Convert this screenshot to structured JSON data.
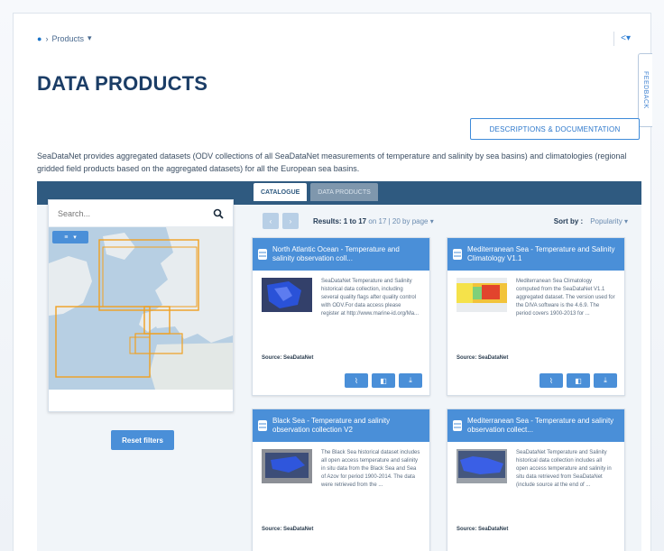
{
  "breadcrumb": {
    "home_icon": "home-icon",
    "label": "Products",
    "separator": "›"
  },
  "header": {
    "share_icon": "share-icon",
    "feedback": "FEEDBACK"
  },
  "page_title": "DATA PRODUCTS",
  "doc_button": "DESCRIPTIONS & DOCUMENTATION",
  "intro": "SeaDataNet provides aggregated datasets (ODV collections of all SeaDataNet measurements of temperature and salinity by sea basins) and climatologies (regional gridded field products based on the aggregated datasets) for all the European sea basins.",
  "search": {
    "placeholder": "Search..."
  },
  "map": {
    "layer_label": "≡"
  },
  "reset_button": "Reset filters",
  "tabs": [
    "CATALOGUE",
    "DATA PRODUCTS"
  ],
  "pager": {
    "results_label": "Results: 1 to 17",
    "results_extra": "on 17 | 20 by page ▾",
    "sort_label": "Sort by :",
    "sort_value": "Popularity ▾"
  },
  "cards": [
    {
      "title": "North Atlantic Ocean - Temperature and salinity observation coll...",
      "text": "SeaDataNet Temperature and Salinity historical data collection, including several quality flags after quality control with ODV.For data access please register at http://www.marine-id.org/Ma...",
      "source": "Source: SeaDataNet"
    },
    {
      "title": "Mediterranean Sea - Temperature and Salinity Climatology V1.1",
      "text": "Mediterranean Sea Climatology computed from the SeaDataNet V1.1 aggregated dataset. The version used for the DIVA software is the 4.6.9. The period covers 1900-2013 for ...",
      "source": "Source: SeaDataNet"
    },
    {
      "title": "Black Sea - Temperature and salinity observation collection V2",
      "text": "The Black Sea historical dataset includes all open access temperature and salinity in situ data from the Black Sea and Sea of Azov for period 1900-2014. The data were retrieved from the ...",
      "source": "Source: SeaDataNet"
    },
    {
      "title": "Mediterranean Sea - Temperature and salinity observation collect...",
      "text": "SeaDataNet Temperature and Salinity historical data collection includes all open access temperature and salinity in situ data retrieved from SeaDataNet (include source at the end of ...",
      "source": "Source: SeaDataNet"
    }
  ],
  "card_actions": [
    "view-icon",
    "filter-icon",
    "download-icon"
  ],
  "colors": {
    "brand_blue": "#4a8fd8",
    "header_bar": "#2f5a80",
    "title": "#1b3d66"
  }
}
